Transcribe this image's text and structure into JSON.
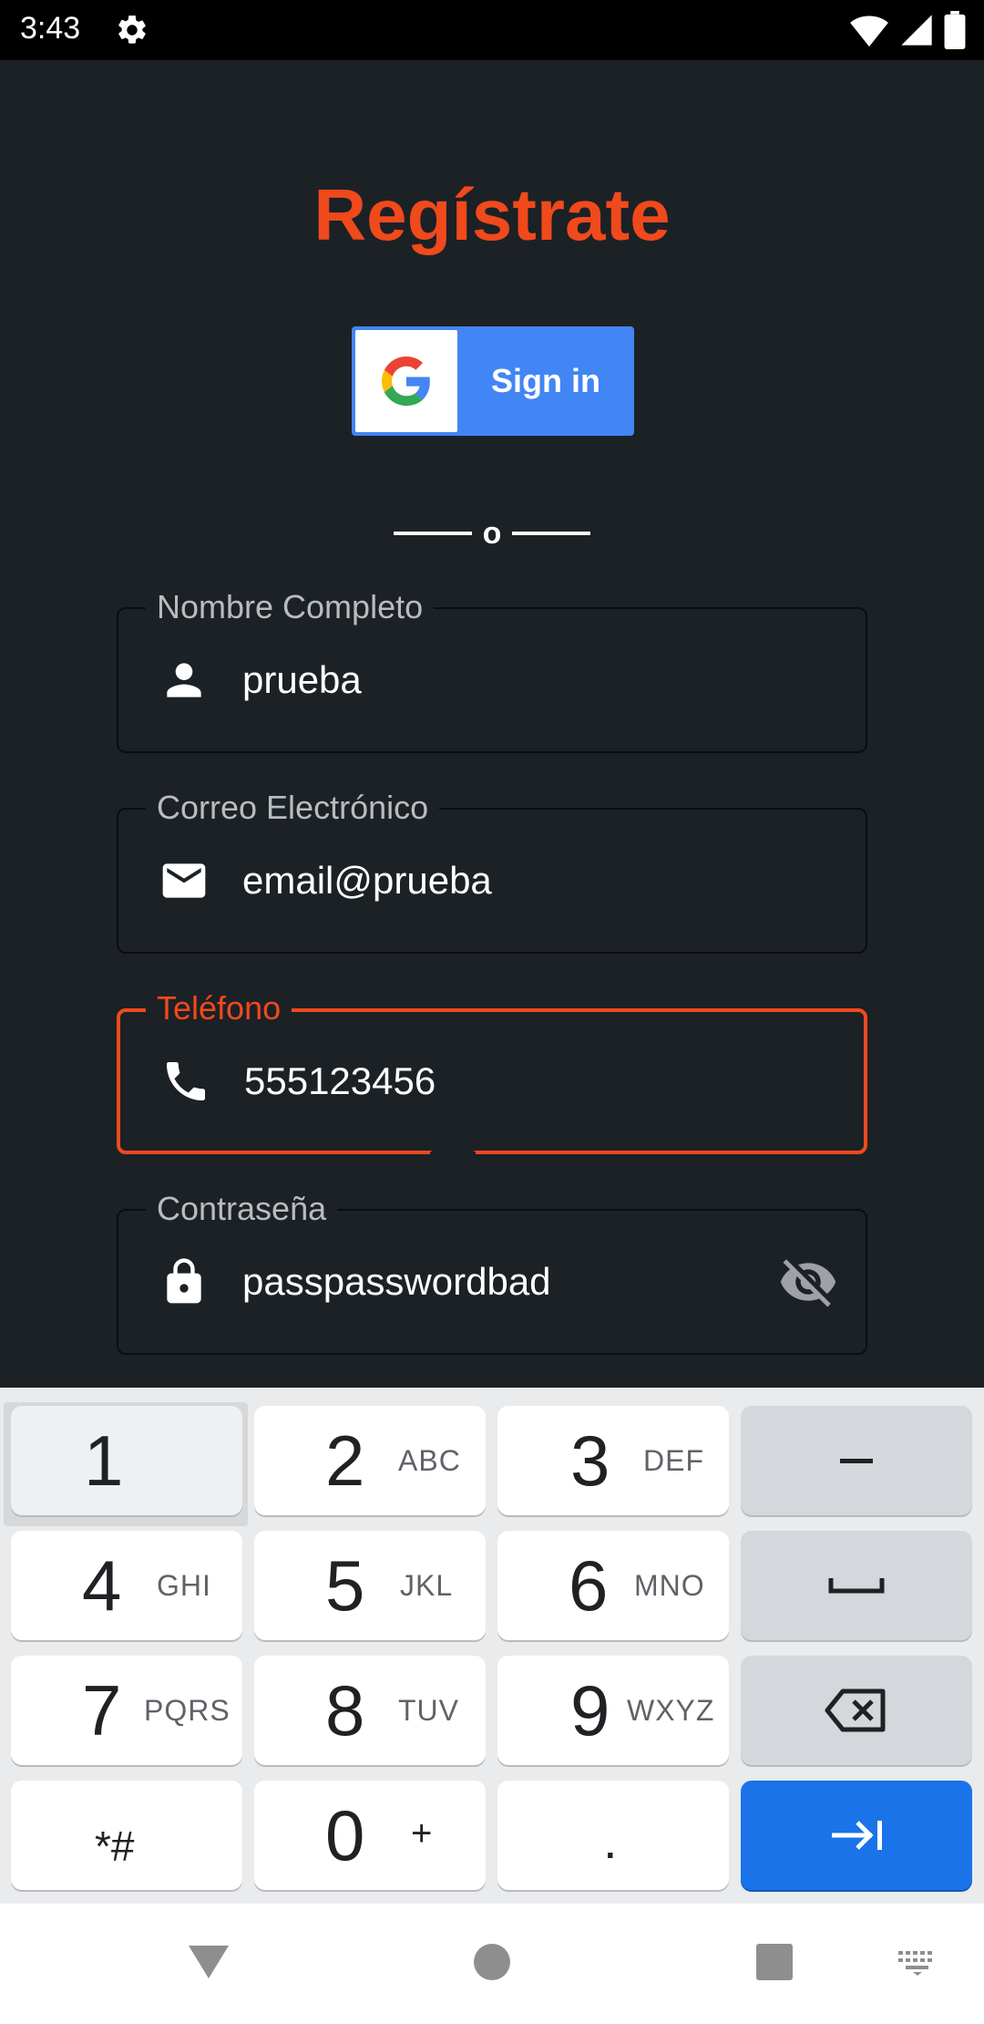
{
  "status_bar": {
    "time": "3:43",
    "icons": [
      "gear-icon",
      "wifi-icon",
      "signal-icon",
      "battery-icon"
    ]
  },
  "header": {
    "title": "Regístrate"
  },
  "google_button": {
    "label": "Sign in",
    "icon": "google-logo-icon"
  },
  "divider": {
    "text": "o"
  },
  "form": {
    "fields": [
      {
        "label": "Nombre Completo",
        "value": "prueba",
        "icon": "person-icon"
      },
      {
        "label": "Correo Electrónico",
        "value": "email@prueba",
        "icon": "mail-icon"
      },
      {
        "label": "Teléfono",
        "value": "555123456",
        "icon": "phone-icon",
        "focused": true
      },
      {
        "label": "Contraseña",
        "value": "passpasswordbad",
        "icon": "lock-icon",
        "trailing_icon": "visibility-off-icon"
      }
    ]
  },
  "keyboard": {
    "keys": [
      {
        "num": "1",
        "sub": ""
      },
      {
        "num": "2",
        "sub": "ABC"
      },
      {
        "num": "3",
        "sub": "DEF"
      },
      {
        "num": "4",
        "sub": "GHI"
      },
      {
        "num": "5",
        "sub": "JKL"
      },
      {
        "num": "6",
        "sub": "MNO"
      },
      {
        "num": "7",
        "sub": "PQRS"
      },
      {
        "num": "8",
        "sub": "TUV"
      },
      {
        "num": "9",
        "sub": "WXYZ"
      },
      {
        "num": "*#",
        "sub": ""
      },
      {
        "num": "0",
        "sub": "+"
      },
      {
        "num": ".",
        "sub": ""
      }
    ],
    "side_keys": [
      "minus-icon",
      "space-icon",
      "backspace-icon",
      "next-field-icon"
    ]
  },
  "nav_bar": {
    "icons": [
      "back-icon",
      "home-icon",
      "recents-icon",
      "keyboard-icon"
    ]
  },
  "colors": {
    "background": "#1c2126",
    "accent": "#f0491c",
    "google_blue": "#4285f4",
    "keyboard_blue": "#1a73e8"
  }
}
